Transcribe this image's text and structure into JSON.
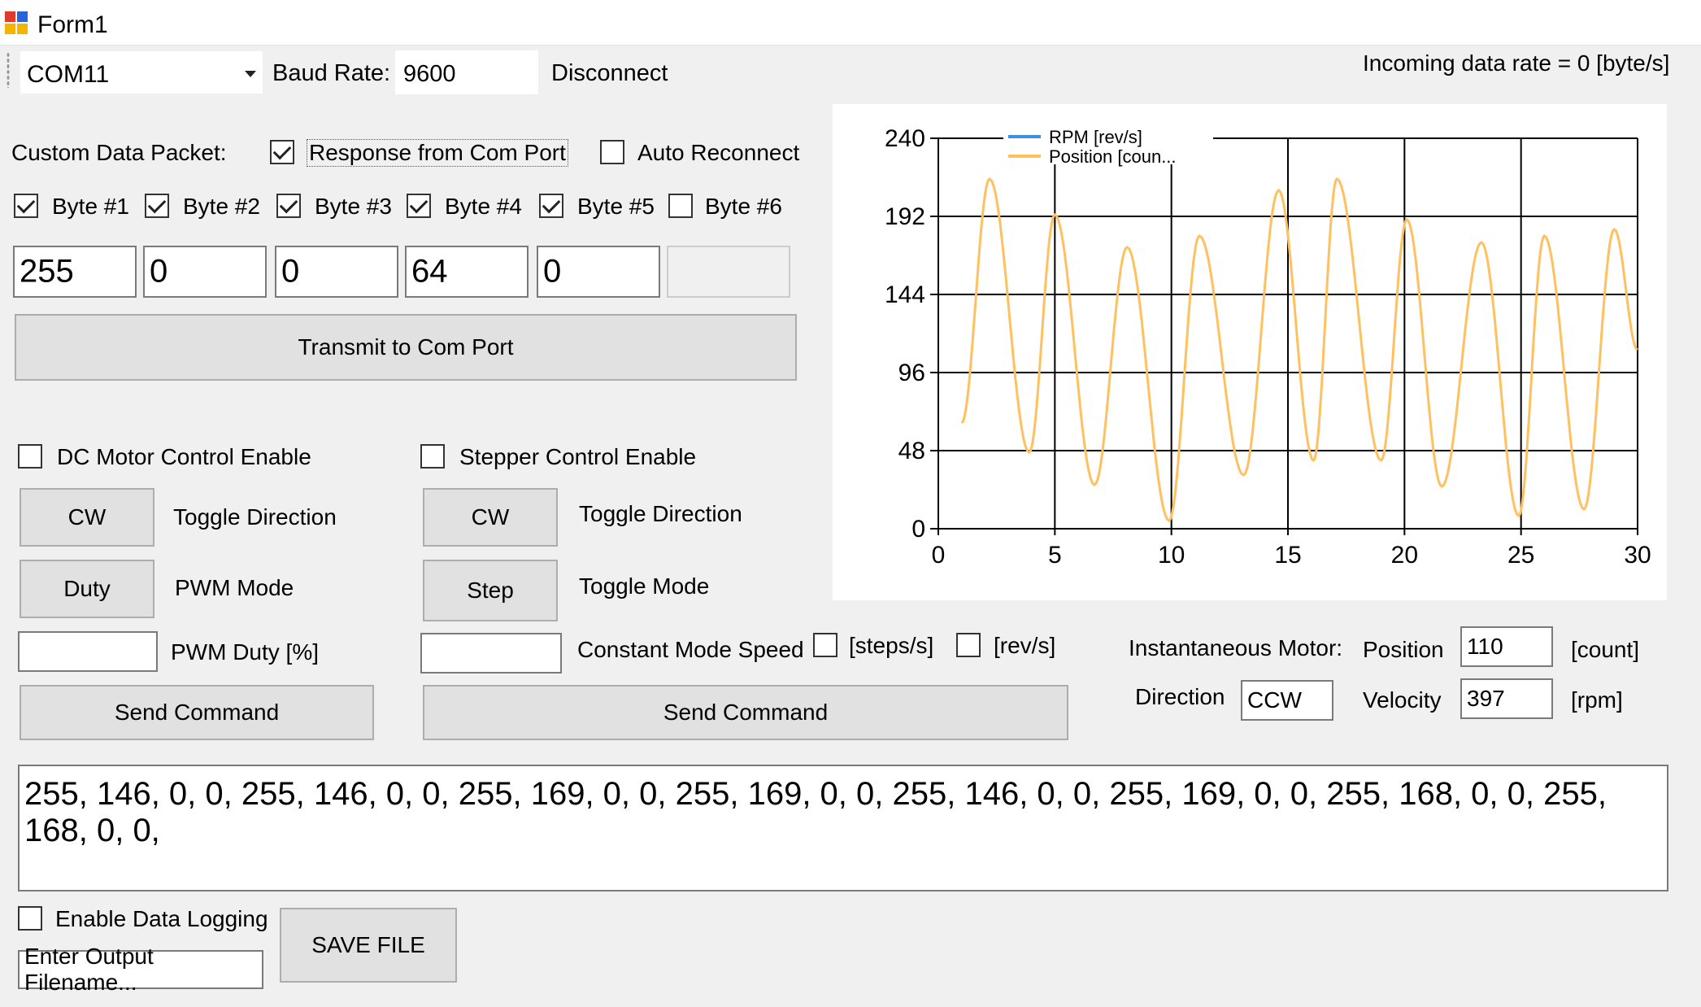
{
  "window": {
    "title": "Form1"
  },
  "toolbar": {
    "com_port": "COM11",
    "baud_label": "Baud Rate:",
    "baud_value": "9600",
    "disconnect_label": "Disconnect",
    "incoming_rate": "Incoming data rate = 0 [byte/s]"
  },
  "packet": {
    "label": "Custom Data Packet:",
    "response_label": "Response from Com Port",
    "response_checked": true,
    "auto_reconnect_label": "Auto Reconnect",
    "auto_reconnect_checked": false,
    "bytes": [
      {
        "label": "Byte #1",
        "checked": true,
        "value": "255"
      },
      {
        "label": "Byte #2",
        "checked": true,
        "value": "0"
      },
      {
        "label": "Byte #3",
        "checked": true,
        "value": "0"
      },
      {
        "label": "Byte #4",
        "checked": true,
        "value": "64"
      },
      {
        "label": "Byte #5",
        "checked": true,
        "value": "0"
      },
      {
        "label": "Byte #6",
        "checked": false,
        "value": ""
      }
    ],
    "transmit_label": "Transmit to Com Port"
  },
  "dc_motor": {
    "enable_label": "DC Motor Control Enable",
    "direction_button": "CW",
    "direction_label": "Toggle Direction",
    "mode_button": "Duty",
    "mode_label": "PWM Mode",
    "duty_value": "",
    "duty_label": "PWM Duty [%]",
    "send_label": "Send Command"
  },
  "stepper": {
    "enable_label": "Stepper Control Enable",
    "direction_button": "CW",
    "direction_label": "Toggle Direction",
    "mode_button": "Step",
    "mode_label": "Toggle Mode",
    "speed_value": "",
    "speed_label": "Constant Mode Speed",
    "steps_label": "[steps/s]",
    "rev_label": "[rev/s]",
    "send_label": "Send Command"
  },
  "instant": {
    "label": "Instantaneous Motor:",
    "position_label": "Position",
    "position_value": "110",
    "position_unit": "[count]",
    "direction_label": "Direction",
    "direction_value": "CCW",
    "velocity_label": "Velocity",
    "velocity_value": "397",
    "velocity_unit": "[rpm]"
  },
  "output_text": "255, 146, 0, 0, 255, 146, 0, 0, 255, 169, 0, 0, 255, 169, 0, 0, 255, 146, 0, 0, 255, 169, 0, 0, 255, 168, 0, 0, 255, 168, 0, 0,",
  "logging": {
    "enable_label": "Enable Data Logging",
    "filename_placeholder": "Enter Output Filename...",
    "save_label": "SAVE FILE"
  },
  "chart_data": {
    "type": "line",
    "xlim": [
      0,
      30
    ],
    "ylim": [
      0,
      240
    ],
    "x_ticks": [
      "0",
      "5",
      "10",
      "15",
      "20",
      "25",
      "30"
    ],
    "y_ticks": [
      "0",
      "48",
      "96",
      "144",
      "192",
      "240"
    ],
    "legend_position": "top-left",
    "grid": true,
    "series": [
      {
        "name": "RPM [rev/s]",
        "color": "#3b8fe8",
        "x": [],
        "y": []
      },
      {
        "name": "Position [coun...",
        "color": "#ffc060",
        "x": [
          1.0,
          2.2,
          3.9,
          5.0,
          6.7,
          8.1,
          9.9,
          11.2,
          13.1,
          14.6,
          16.1,
          17.1,
          19.0,
          20.1,
          21.6,
          23.3,
          24.9,
          26.0,
          27.7,
          29.0,
          30.0
        ],
        "y": [
          65,
          215,
          47,
          193,
          27,
          173,
          5,
          180,
          33,
          208,
          42,
          215,
          42,
          190,
          26,
          176,
          8,
          180,
          12,
          184,
          110
        ]
      }
    ]
  }
}
